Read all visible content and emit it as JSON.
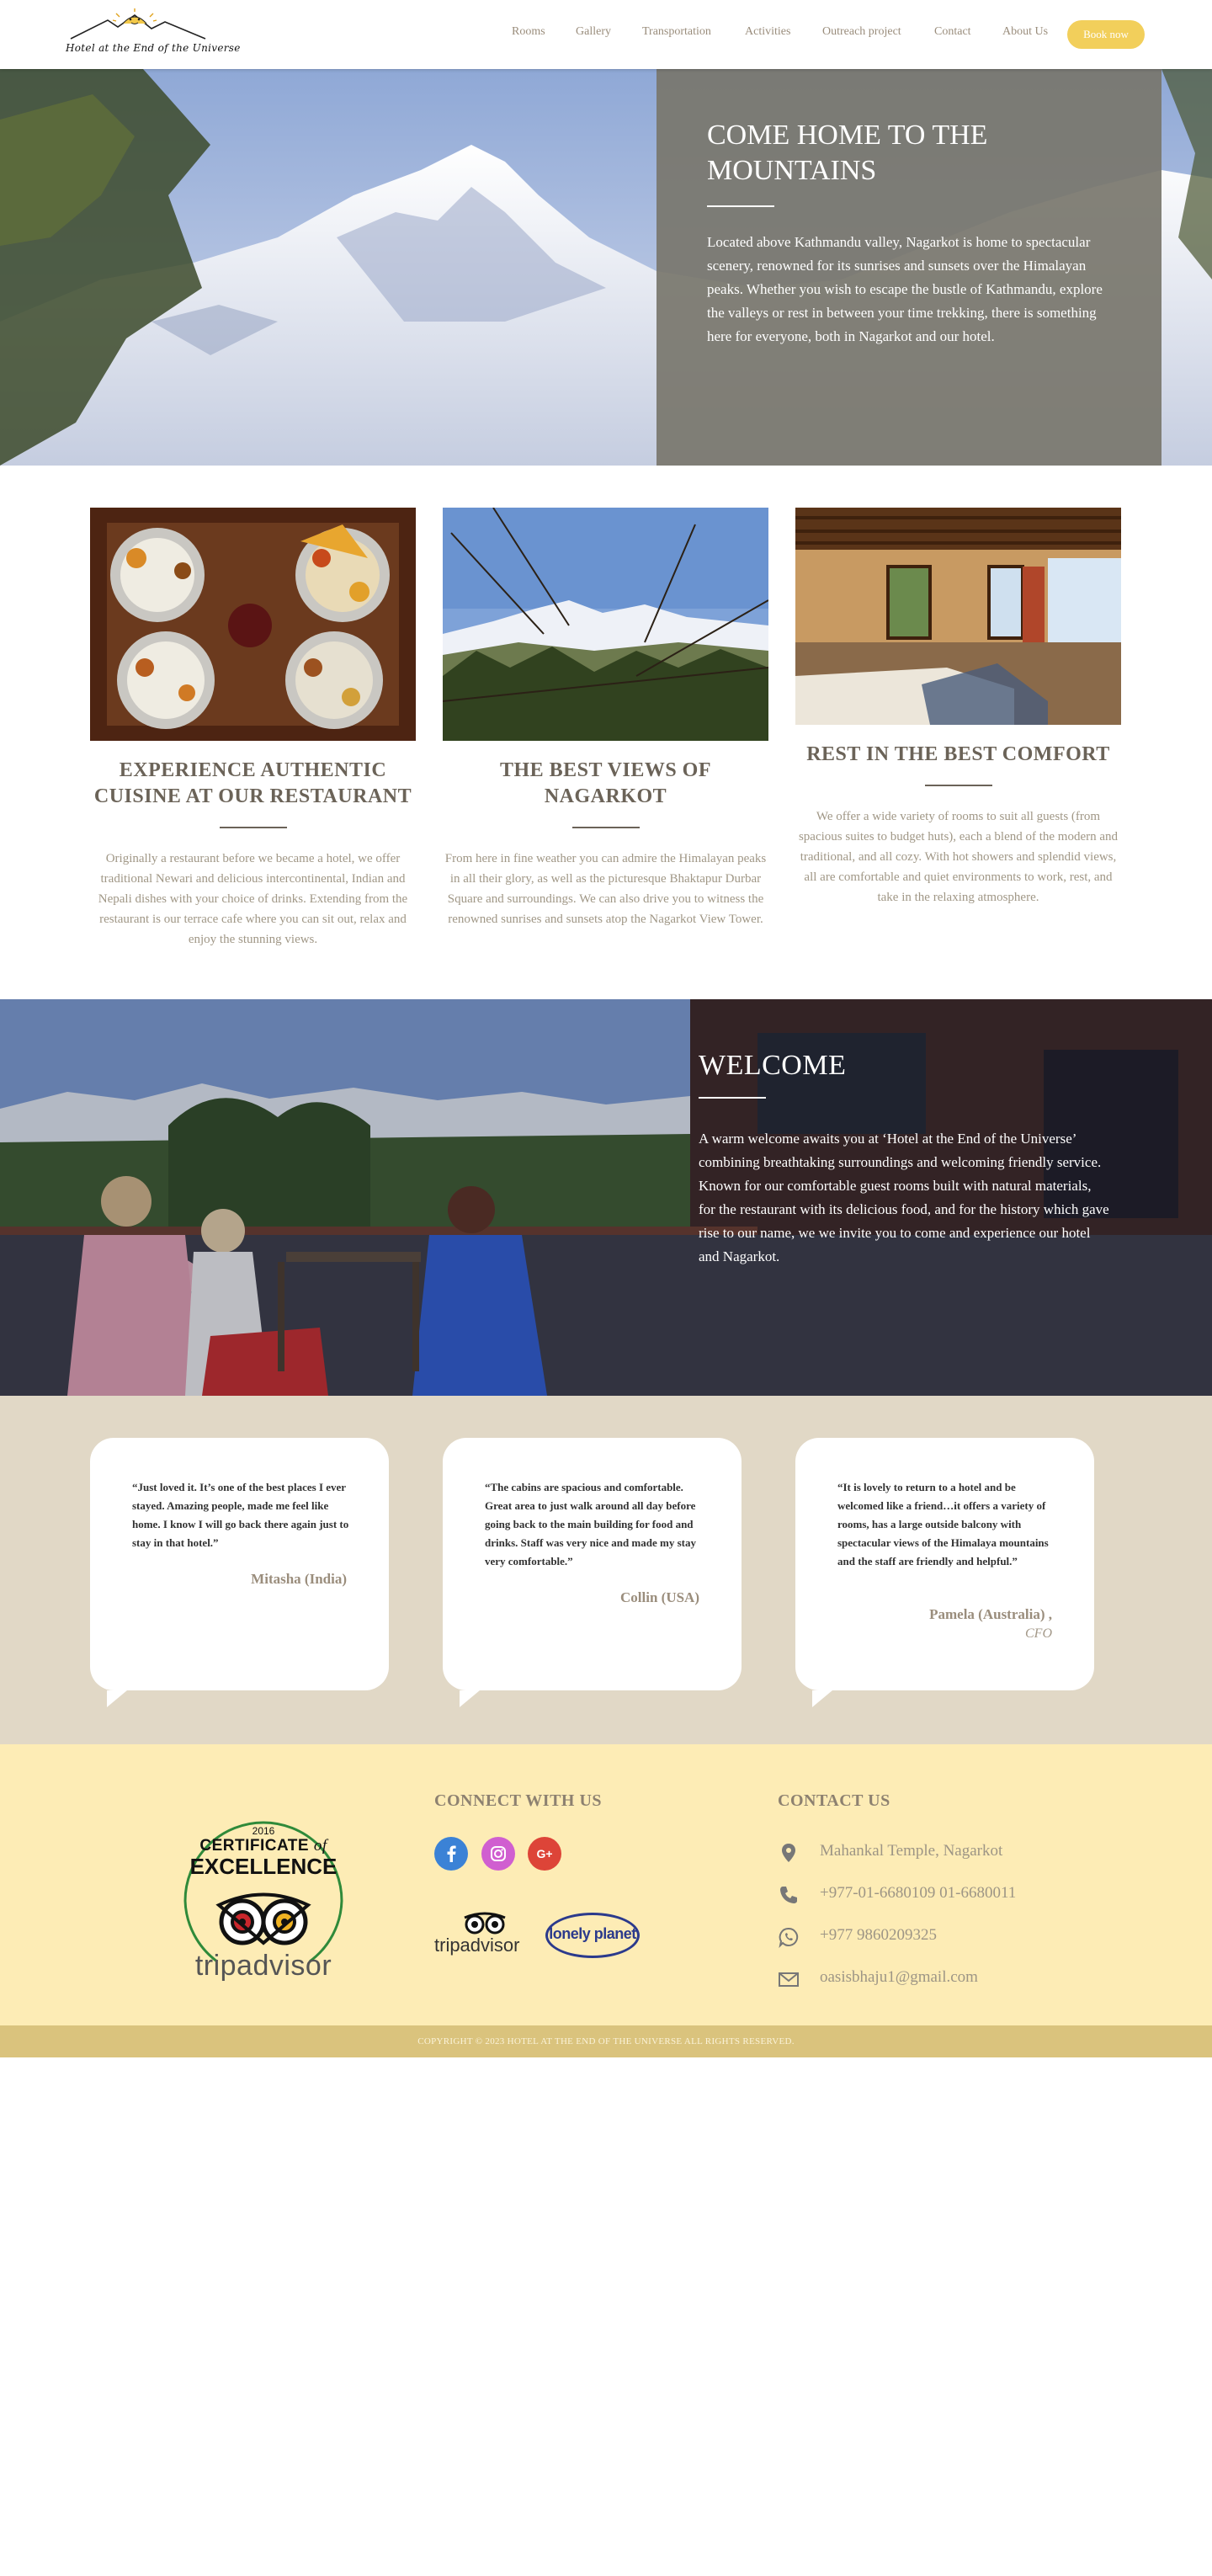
{
  "header": {
    "logo_text": "Hotel at the End of the Universe",
    "nav": [
      "Rooms",
      "Gallery",
      "Transportation",
      "Activities",
      "Outreach project",
      "Contact",
      "About Us"
    ],
    "book_label": "Book now"
  },
  "hero": {
    "title": "COME HOME TO THE MOUNTAINS",
    "text": "Located above Kathmandu valley, Nagarkot is home to spectacular scenery, renowned for its sunrises and sunsets over the Himalayan peaks. Whether you wish to escape the bustle of Kathmandu, explore the valleys or rest in between your time trekking, there is something here for everyone, both in Nagarkot and our hotel."
  },
  "features": [
    {
      "title": "EXPERIENCE AUTHENTIC CUISINE AT OUR RESTAURANT",
      "text": "Originally a restaurant before we became a hotel, we offer traditional Newari and delicious intercontinental, Indian and Nepali dishes with your choice of drinks. Extending from the restaurant is our terrace cafe where you can sit out, relax and enjoy the stunning views."
    },
    {
      "title": "THE BEST VIEWS OF NAGARKOT",
      "text": "From here in fine weather you can admire the Himalayan peaks in all their glory, as well as the picturesque Bhaktapur Durbar Square and surroundings. We can also drive you to witness the renowned sunrises and sunsets atop the Nagarkot View Tower."
    },
    {
      "title": "REST IN THE BEST COMFORT",
      "text": "We offer a wide variety of rooms to suit all guests (from spacious suites to budget huts), each a blend of the modern and traditional, and all cozy. With hot showers and splendid views, all are comfortable and quiet environments to work, rest, and take in the relaxing atmosphere."
    }
  ],
  "welcome": {
    "title": "WELCOME",
    "text": "A warm welcome awaits you at ‘Hotel at the End of the Universe’ combining breathtaking surroundings and welcoming friendly service. Known for our comfortable guest rooms built with natural materials, for the restaurant with its delicious food, and for the history which gave rise to our name, we we invite you to come and experience our hotel and Nagarkot."
  },
  "testimonials": [
    {
      "quote": "“Just loved it. It’s one of the best places I ever stayed. Amazing people, made me feel like home. I know I will go back there again just to stay in that hotel.”",
      "author": "Mitasha (India)",
      "role": ""
    },
    {
      "quote": "“The cabins are spacious and comfortable. Great area to just walk around all day before going back to the main building for food and drinks. Staff was very nice and made my stay very comfortable.”",
      "author": "Collin (USA)",
      "role": ""
    },
    {
      "quote": "“It is lovely to return to a hotel and be welcomed like a friend…it offers a variety of rooms, has a large outside balcony with spectacular views of the Himalaya mountains and the staff are friendly and helpful.”",
      "author": "Pamela (Australia) ,",
      "role": "CFO"
    }
  ],
  "certificate": {
    "year": "2016",
    "line1": "CERTIFICATE",
    "of": "of",
    "line2": "EXCELLENCE",
    "brand": "tripadvisor"
  },
  "connect": {
    "title": "CONNECT WITH US",
    "partners": [
      "tripadvisor",
      "lonely planet"
    ]
  },
  "contact": {
    "title": "CONTACT US",
    "address": "Mahankal Temple, Nagarkot",
    "phone": "+977-01-6680109 01-6680011",
    "whatsapp": "+977 9860209325",
    "email": "oasisbhaju1@gmail.com"
  },
  "copyright": "COPYRIGHT © 2023 HOTEL AT THE END OF THE UNIVERSE ALL RIGHTS RESERVED.",
  "colors": {
    "accent": "#f2cf5b",
    "footer_bg": "#fdecb5",
    "copyright_bg": "#dac37d",
    "testimonial_bg": "#e1d8c6",
    "heading": "#6b6358"
  }
}
